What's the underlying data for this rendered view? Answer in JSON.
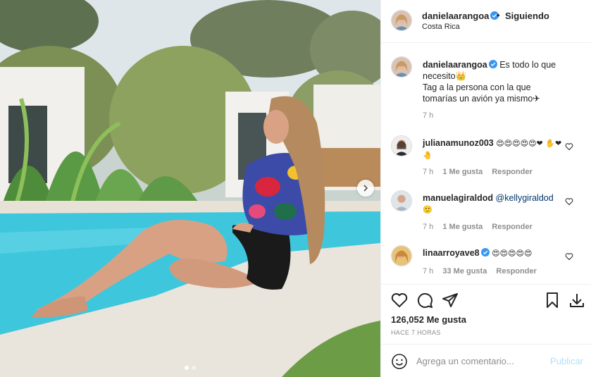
{
  "photo": {
    "alt_icon": "photo-of-woman-by-pool",
    "carousel_dots": 2,
    "active_dot": 0,
    "next_icon": "chevron-right-icon"
  },
  "header": {
    "username": "danielaarangoa",
    "separator": "•",
    "follow_label": "Siguiendo",
    "location": "Costa Rica"
  },
  "caption": {
    "username": "danielaarangoa",
    "line1": "Es todo lo que necesito👑",
    "line2": "Tag a la persona con la que tomarías un avión ya mismo✈",
    "time": "7 h"
  },
  "comments": [
    {
      "username": "julianamunoz003",
      "text": "😍😍😍😍😍❤ ✋❤🤚",
      "time": "7 h",
      "likes": "1 Me gusta",
      "reply": "Responder"
    },
    {
      "username": "manuelagiraldod",
      "mention": "@kellygiraldod",
      "text": "🙂",
      "time": "7 h",
      "likes": "1 Me gusta",
      "reply": "Responder"
    },
    {
      "username": "linaarroyave8",
      "text": "😍😍😍😍😍",
      "time": "7 h",
      "likes": "33 Me gusta",
      "reply": "Responder"
    }
  ],
  "actions": {
    "likes_count": "126,052 Me gusta",
    "timestamp": "HACE 7 HORAS"
  },
  "add_comment": {
    "placeholder": "Agrega un comentario...",
    "post_label": "Publicar"
  },
  "colors": {
    "verified": "#3897f0",
    "post_button": "#b2dffc",
    "pool": "#3ec7dc"
  }
}
